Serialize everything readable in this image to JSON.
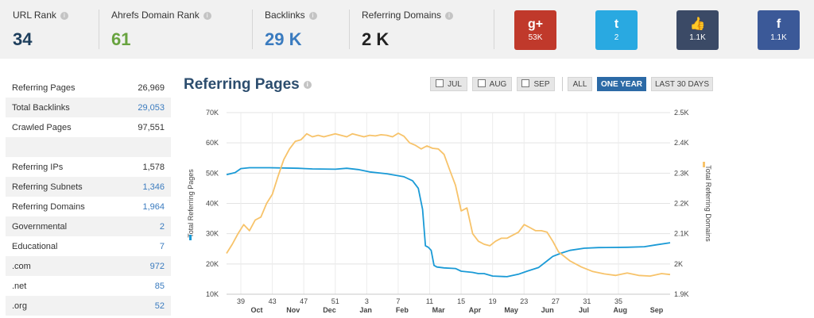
{
  "metrics": [
    {
      "label": "URL Rank",
      "value": "34",
      "color": "#1d3e5c"
    },
    {
      "label": "Ahrefs Domain Rank",
      "value": "61",
      "color": "#68a33f"
    },
    {
      "label": "Backlinks",
      "value": "29 K",
      "color": "#3a7bbf"
    },
    {
      "label": "Referring Domains",
      "value": "2 K",
      "color": "#222222"
    }
  ],
  "info_glyph": "i",
  "social": [
    {
      "network": "google-plus",
      "glyph": "g+",
      "count": "53K",
      "color": "#c0392b"
    },
    {
      "network": "twitter",
      "glyph": "t",
      "count": "2",
      "color": "#29a9e1"
    },
    {
      "network": "like",
      "glyph": "👍",
      "count": "1.1K",
      "color": "#3b4a66"
    },
    {
      "network": "facebook",
      "glyph": "f",
      "count": "1.1K",
      "color": "#3b5998"
    }
  ],
  "stats": [
    {
      "label": "Referring Pages",
      "value": "26,969",
      "style": "dark"
    },
    {
      "label": "Total Backlinks",
      "value": "29,053",
      "style": "link"
    },
    {
      "label": "Crawled Pages",
      "value": "97,551",
      "style": "dark"
    },
    {
      "spacer": true
    },
    {
      "label": "Referring IPs",
      "value": "1,578",
      "style": "dark"
    },
    {
      "label": "Referring Subnets",
      "value": "1,346",
      "style": "link"
    },
    {
      "label": "Referring Domains",
      "value": "1,964",
      "style": "link"
    },
    {
      "label": "Governmental",
      "value": "2",
      "style": "link"
    },
    {
      "label": "Educational",
      "value": "7",
      "style": "link"
    },
    {
      "label": ".com",
      "value": "972",
      "style": "link"
    },
    {
      "label": ".net",
      "value": "85",
      "style": "link"
    },
    {
      "label": ".org",
      "value": "52",
      "style": "link"
    }
  ],
  "chart_title": "Referring Pages",
  "buttons": {
    "jul": "JUL",
    "aug": "AUG",
    "sep": "SEP",
    "all": "ALL",
    "one_year": "ONE YEAR",
    "last30": "LAST 30 DAYS"
  },
  "chart_data": {
    "type": "line",
    "ylabel_left": "Total Referring Pages",
    "ylabel_right": "Total Referring Domains",
    "left_ticks": [
      "10K",
      "20K",
      "30K",
      "40K",
      "50K",
      "60K",
      "70K"
    ],
    "left_ylim": [
      10000,
      70000
    ],
    "right_ticks": [
      "1.9K",
      "2K",
      "2.1K",
      "2.2K",
      "2.3K",
      "2.4K",
      "2.5K"
    ],
    "right_ylim": [
      1900,
      2500
    ],
    "week_ticks": [
      "39",
      "43",
      "47",
      "51",
      "3",
      "7",
      "11",
      "15",
      "19",
      "23",
      "27",
      "31",
      "35"
    ],
    "month_ticks": [
      "Oct",
      "Nov",
      "Dec",
      "Jan",
      "Feb",
      "Mar",
      "Apr",
      "May",
      "Jun",
      "Jul",
      "Aug",
      "Sep"
    ],
    "series": [
      {
        "name": "Total Referring Pages",
        "axis": "left",
        "color": "#1a9ad6",
        "points": [
          [
            0,
            49500
          ],
          [
            0.03,
            50200
          ],
          [
            0.05,
            51500
          ],
          [
            0.08,
            51800
          ],
          [
            0.15,
            51800
          ],
          [
            0.25,
            51600
          ],
          [
            0.3,
            51400
          ],
          [
            0.38,
            51300
          ],
          [
            0.42,
            51600
          ],
          [
            0.46,
            51200
          ],
          [
            0.5,
            50400
          ],
          [
            0.56,
            49800
          ],
          [
            0.62,
            48800
          ],
          [
            0.65,
            47500
          ],
          [
            0.67,
            45000
          ],
          [
            0.685,
            38000
          ],
          [
            0.695,
            26000
          ],
          [
            0.705,
            25500
          ],
          [
            0.715,
            24500
          ],
          [
            0.725,
            19500
          ],
          [
            0.735,
            19000
          ],
          [
            0.76,
            18700
          ],
          [
            0.8,
            18500
          ],
          [
            0.82,
            17600
          ],
          [
            0.86,
            17200
          ],
          [
            0.88,
            16800
          ],
          [
            0.9,
            16800
          ],
          [
            0.93,
            16000
          ],
          [
            0.98,
            15800
          ],
          [
            1.02,
            16600
          ],
          [
            1.05,
            17600
          ],
          [
            1.09,
            18800
          ],
          [
            1.12,
            21000
          ],
          [
            1.14,
            22500
          ],
          [
            1.17,
            23600
          ],
          [
            1.2,
            24500
          ],
          [
            1.25,
            25200
          ],
          [
            1.3,
            25400
          ],
          [
            1.4,
            25500
          ],
          [
            1.46,
            25700
          ],
          [
            1.5,
            26300
          ],
          [
            1.55,
            27000
          ]
        ]
      },
      {
        "name": "Total Referring Domains",
        "axis": "right",
        "color": "#f7c36a",
        "points": [
          [
            0,
            2035
          ],
          [
            0.02,
            2065
          ],
          [
            0.04,
            2100
          ],
          [
            0.06,
            2130
          ],
          [
            0.08,
            2110
          ],
          [
            0.1,
            2145
          ],
          [
            0.12,
            2155
          ],
          [
            0.14,
            2200
          ],
          [
            0.16,
            2230
          ],
          [
            0.18,
            2290
          ],
          [
            0.2,
            2345
          ],
          [
            0.22,
            2380
          ],
          [
            0.24,
            2405
          ],
          [
            0.26,
            2410
          ],
          [
            0.28,
            2430
          ],
          [
            0.3,
            2420
          ],
          [
            0.32,
            2425
          ],
          [
            0.34,
            2420
          ],
          [
            0.36,
            2425
          ],
          [
            0.38,
            2430
          ],
          [
            0.4,
            2425
          ],
          [
            0.42,
            2420
          ],
          [
            0.44,
            2430
          ],
          [
            0.46,
            2425
          ],
          [
            0.48,
            2420
          ],
          [
            0.5,
            2425
          ],
          [
            0.52,
            2423
          ],
          [
            0.54,
            2427
          ],
          [
            0.56,
            2425
          ],
          [
            0.58,
            2420
          ],
          [
            0.6,
            2432
          ],
          [
            0.62,
            2422
          ],
          [
            0.64,
            2400
          ],
          [
            0.66,
            2392
          ],
          [
            0.68,
            2380
          ],
          [
            0.7,
            2390
          ],
          [
            0.72,
            2382
          ],
          [
            0.74,
            2380
          ],
          [
            0.76,
            2362
          ],
          [
            0.78,
            2310
          ],
          [
            0.8,
            2260
          ],
          [
            0.82,
            2175
          ],
          [
            0.84,
            2185
          ],
          [
            0.86,
            2100
          ],
          [
            0.88,
            2075
          ],
          [
            0.9,
            2065
          ],
          [
            0.92,
            2060
          ],
          [
            0.94,
            2075
          ],
          [
            0.96,
            2085
          ],
          [
            0.98,
            2085
          ],
          [
            1.0,
            2095
          ],
          [
            1.02,
            2105
          ],
          [
            1.04,
            2130
          ],
          [
            1.06,
            2120
          ],
          [
            1.08,
            2110
          ],
          [
            1.1,
            2110
          ],
          [
            1.12,
            2105
          ],
          [
            1.14,
            2075
          ],
          [
            1.16,
            2040
          ],
          [
            1.2,
            2010
          ],
          [
            1.24,
            1990
          ],
          [
            1.28,
            1975
          ],
          [
            1.32,
            1967
          ],
          [
            1.36,
            1962
          ],
          [
            1.4,
            1970
          ],
          [
            1.44,
            1962
          ],
          [
            1.48,
            1960
          ],
          [
            1.52,
            1968
          ],
          [
            1.55,
            1965
          ]
        ]
      }
    ],
    "x_domain": [
      0,
      1.55
    ],
    "grid": true,
    "legend": "none"
  }
}
